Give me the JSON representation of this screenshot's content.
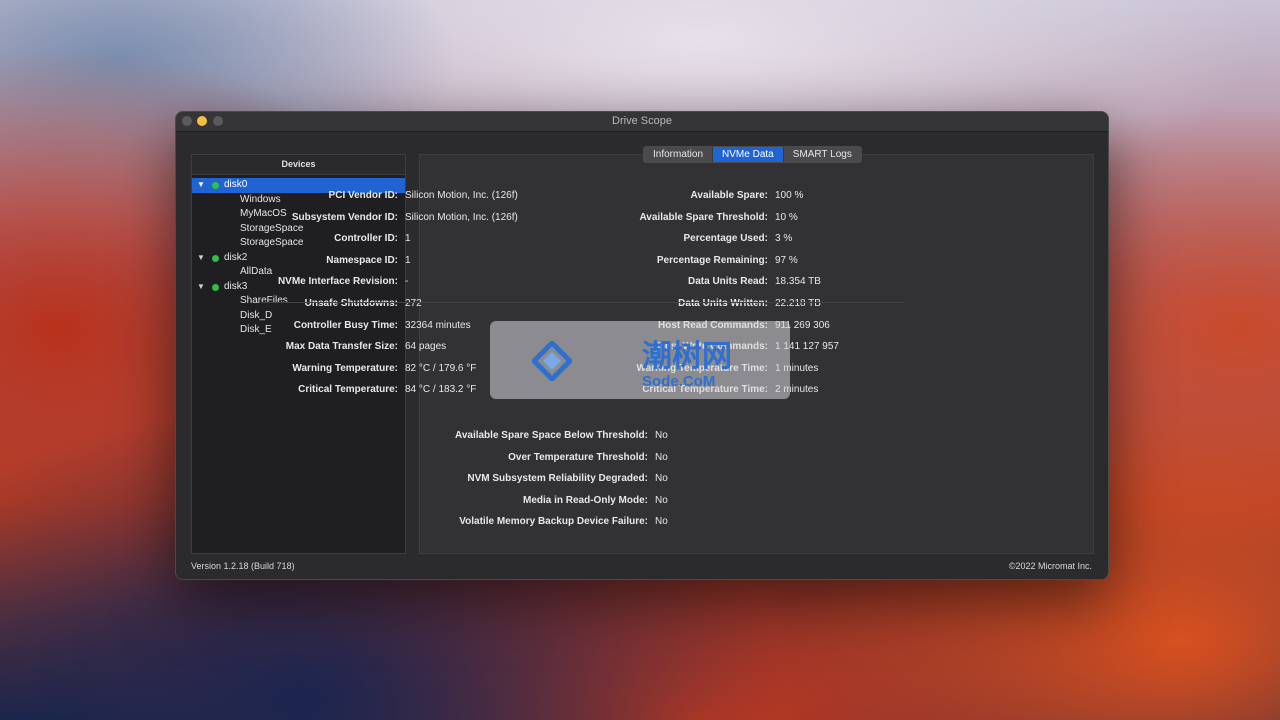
{
  "window": {
    "title": "Drive Scope"
  },
  "sidebar": {
    "header": "Devices",
    "items": [
      {
        "label": "disk0",
        "level": 0,
        "expanded": true,
        "selected": true,
        "status": "green"
      },
      {
        "label": "Windows",
        "level": 1
      },
      {
        "label": "MyMacOS",
        "level": 1
      },
      {
        "label": "StorageSpace",
        "level": 1
      },
      {
        "label": "StorageSpace",
        "level": 1
      },
      {
        "label": "disk2",
        "level": 0,
        "expanded": true,
        "status": "green"
      },
      {
        "label": "AllData",
        "level": 1
      },
      {
        "label": "disk3",
        "level": 0,
        "expanded": true,
        "status": "green"
      },
      {
        "label": "ShareFiles",
        "level": 1
      },
      {
        "label": "Disk_D",
        "level": 1
      },
      {
        "label": "Disk_E",
        "level": 1
      }
    ]
  },
  "tabs": [
    {
      "label": "Information",
      "active": false
    },
    {
      "label": "NVMe Data",
      "active": true
    },
    {
      "label": "SMART Logs",
      "active": false
    }
  ],
  "nvme_left": [
    {
      "key": "PCI Vendor ID:",
      "value": "Silicon Motion, Inc. (126f)"
    },
    {
      "key": "Subsystem Vendor ID:",
      "value": "Silicon Motion, Inc. (126f)"
    },
    {
      "key": "Controller ID:",
      "value": "1"
    },
    {
      "key": "Namespace ID:",
      "value": "1"
    },
    {
      "key": "NVMe Interface Revision:",
      "value": "-"
    },
    {
      "key": "Unsafe Shutdowns:",
      "value": "272"
    },
    {
      "key": "Controller Busy Time:",
      "value": "32364 minutes"
    },
    {
      "key": "Max Data Transfer Size:",
      "value": "64 pages"
    },
    {
      "key": "Warning Temperature:",
      "value": "82 °C / 179.6 °F"
    },
    {
      "key": "Critical Temperature:",
      "value": "84 °C / 183.2 °F"
    }
  ],
  "nvme_right": [
    {
      "key": "Available Spare:",
      "value": "100 %"
    },
    {
      "key": "Available Spare Threshold:",
      "value": "10 %"
    },
    {
      "key": "Percentage Used:",
      "value": "3 %"
    },
    {
      "key": "Percentage Remaining:",
      "value": "97 %"
    },
    {
      "key": "Data Units Read:",
      "value": "18.354 TB"
    },
    {
      "key": "Data Units Written:",
      "value": "22.218 TB"
    },
    {
      "key": "Host Read Commands:",
      "value": "911 269 306"
    },
    {
      "key": "Host Write Commands:",
      "value": "1 141 127 957"
    },
    {
      "key": "Warning Temperature Time:",
      "value": "1 minutes"
    },
    {
      "key": "Critical Temperature Time:",
      "value": "2 minutes"
    }
  ],
  "nvme_flags": [
    {
      "key": "Available Spare Space Below Threshold:",
      "value": "No"
    },
    {
      "key": "Over Temperature Threshold:",
      "value": "No"
    },
    {
      "key": "NVM Subsystem Reliability Degraded:",
      "value": "No"
    },
    {
      "key": "Media in Read-Only Mode:",
      "value": "No"
    },
    {
      "key": "Volatile Memory Backup Device Failure:",
      "value": "No"
    }
  ],
  "footer": {
    "version": "Version 1.2.18 (Build 718)",
    "copyright": "©2022 Micromat Inc."
  },
  "watermark": {
    "cn": "潮树网",
    "en": "Sode.CoM"
  },
  "colors": {
    "accent": "#1f63d4",
    "status_green": "#2fbf4a",
    "window_bg": "#2b2b2d"
  }
}
